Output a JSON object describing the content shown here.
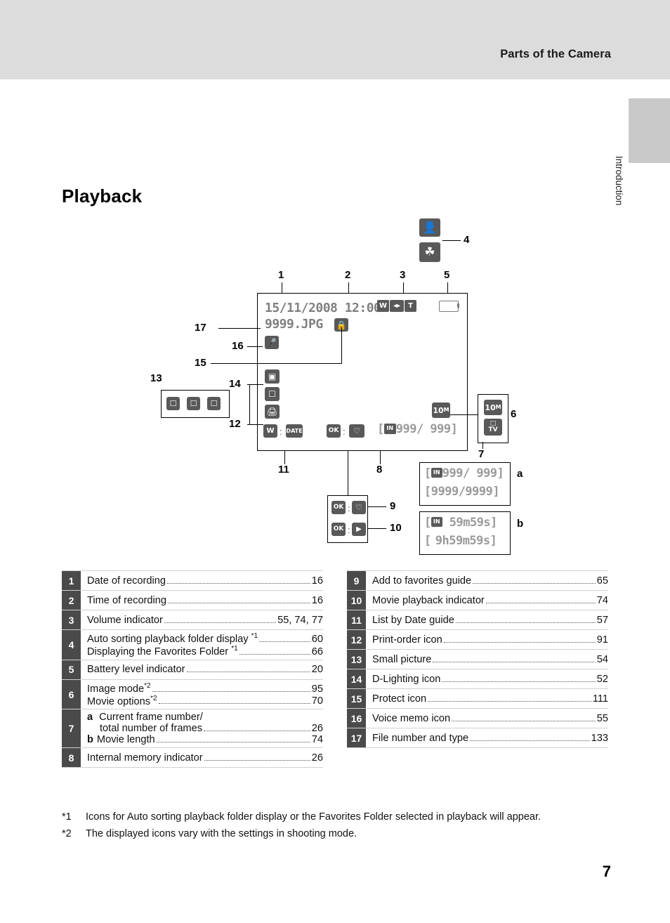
{
  "header": {
    "running_head": "Parts of the Camera",
    "side_tab": "Introduction"
  },
  "title": "Playback",
  "page_number": "7",
  "screen": {
    "date": "15/11/2008 12:00",
    "file": "9999.JPG",
    "zoom_w": "W",
    "zoom_t": "T",
    "image_mode": "10",
    "image_mode_sub": "M",
    "movie_mode_top": "10",
    "movie_mode_topsub": "M",
    "movie_mode_bottom": "TV",
    "frames": "999/  999",
    "frames_prefix": "IN",
    "ok_label": "OK",
    "date_label": "DATE",
    "w_label": "W"
  },
  "callouts": {
    "a_line1": "999/  999",
    "a_line2": "9999/9999",
    "b_line1": "59m59s",
    "b_line2": "9h59m59s",
    "guide9": "OK",
    "guide10": "OK",
    "a_label": "a",
    "b_label": "b"
  },
  "numbers": {
    "n1": "1",
    "n2": "2",
    "n3": "3",
    "n4": "4",
    "n5": "5",
    "n6": "6",
    "n7": "7",
    "n8": "8",
    "n9": "9",
    "n10": "10",
    "n11": "11",
    "n12": "12",
    "n13": "13",
    "n14": "14",
    "n15": "15",
    "n16": "16",
    "n17": "17"
  },
  "legend_left": [
    {
      "num": "1",
      "lines": [
        {
          "label": "Date of recording",
          "page": "16"
        }
      ]
    },
    {
      "num": "2",
      "lines": [
        {
          "label": "Time of recording",
          "page": "16"
        }
      ]
    },
    {
      "num": "3",
      "lines": [
        {
          "label": "Volume indicator",
          "page": "55, 74, 77"
        }
      ]
    },
    {
      "num": "4",
      "lines": [
        {
          "label": "Auto sorting playback folder display *1",
          "page": "60"
        },
        {
          "label": "Displaying the Favorites Folder *1",
          "page": "66"
        }
      ]
    },
    {
      "num": "5",
      "lines": [
        {
          "label": "Battery level indicator",
          "page": "20"
        }
      ]
    },
    {
      "num": "6",
      "lines": [
        {
          "label": "Image mode*2",
          "page": "95"
        },
        {
          "label": "Movie options*2",
          "page": "70"
        }
      ]
    },
    {
      "num": "7",
      "lines": [
        {
          "label": "a  Current frame number/",
          "page": ""
        },
        {
          "label": "total number of frames",
          "page": "26",
          "indent": true
        },
        {
          "label": "b Movie length",
          "page": "74"
        }
      ]
    },
    {
      "num": "8",
      "lines": [
        {
          "label": "Internal memory indicator",
          "page": "26"
        }
      ]
    }
  ],
  "legend_right": [
    {
      "num": "9",
      "lines": [
        {
          "label": "Add to favorites guide",
          "page": "65"
        }
      ]
    },
    {
      "num": "10",
      "lines": [
        {
          "label": "Movie playback indicator",
          "page": "74"
        }
      ]
    },
    {
      "num": "11",
      "lines": [
        {
          "label": "List by Date guide",
          "page": "57"
        }
      ]
    },
    {
      "num": "12",
      "lines": [
        {
          "label": "Print-order icon",
          "page": "91"
        }
      ]
    },
    {
      "num": "13",
      "lines": [
        {
          "label": "Small picture",
          "page": "54"
        }
      ]
    },
    {
      "num": "14",
      "lines": [
        {
          "label": "D-Lighting icon",
          "page": "52"
        }
      ]
    },
    {
      "num": "15",
      "lines": [
        {
          "label": "Protect icon",
          "page": "111"
        }
      ]
    },
    {
      "num": "16",
      "lines": [
        {
          "label": "Voice memo icon",
          "page": "55"
        }
      ]
    },
    {
      "num": "17",
      "lines": [
        {
          "label": "File number and type",
          "page": "133"
        }
      ]
    }
  ],
  "footnotes": [
    {
      "mark": "*1",
      "text": "Icons for Auto sorting playback folder display or the Favorites Folder selected in playback will appear."
    },
    {
      "mark": "*2",
      "text": "The displayed icons vary with the settings in shooting mode."
    }
  ]
}
